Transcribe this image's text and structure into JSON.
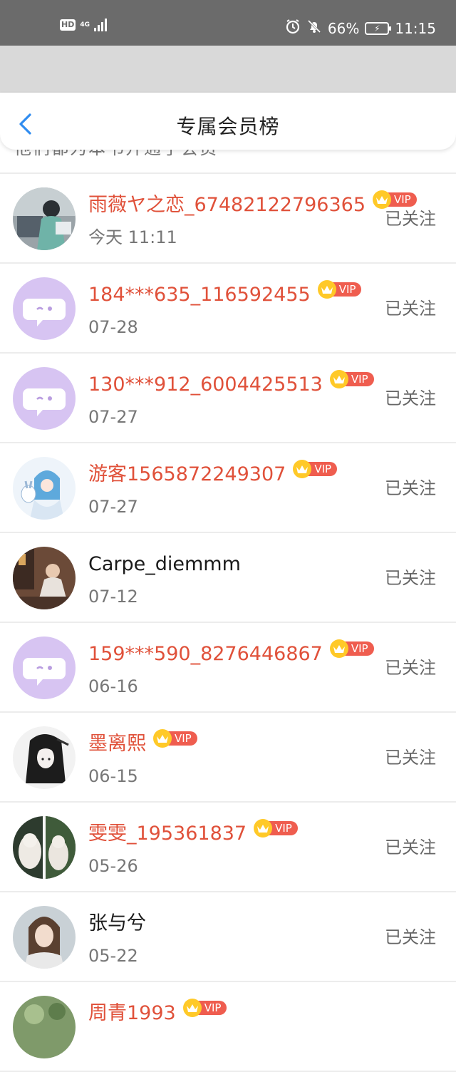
{
  "status_bar": {
    "hd": "HD",
    "network": "4G",
    "battery_percent": "66%",
    "time": "11:15",
    "icons": [
      "alarm-icon",
      "mute-bell-icon",
      "charging-battery-icon",
      "signal-bars-icon"
    ]
  },
  "header": {
    "title": "专属会员榜",
    "behind_text": "他们都为本书开通了会员"
  },
  "colors": {
    "vip_name": "#e0513a",
    "vip_tag": "#ef5d4f",
    "crown": "#ffc928",
    "back_arrow": "#2f8cf0",
    "status_bar": "#6b6b6b"
  },
  "members": [
    {
      "name": "雨薇ヤ之恋_67482122796365",
      "date": "今天 11:11",
      "vip": true,
      "vip_label": "VIP",
      "follow": "已关注",
      "avatar": "anime-girl-avatar"
    },
    {
      "name": "184***635_116592455",
      "date": "07-28",
      "vip": true,
      "vip_label": "VIP",
      "follow": "已关注",
      "avatar": "default-chat-avatar"
    },
    {
      "name": "130***912_6004425513",
      "date": "07-27",
      "vip": true,
      "vip_label": "VIP",
      "follow": "已关注",
      "avatar": "default-chat-avatar"
    },
    {
      "name": "游客1565872249307",
      "date": "07-27",
      "vip": true,
      "vip_label": "VIP",
      "follow": "已关注",
      "avatar": "anime-blue-avatar"
    },
    {
      "name": "Carpe_diemmm",
      "date": "07-12",
      "vip": false,
      "vip_label": "",
      "follow": "已关注",
      "avatar": "photo-person-avatar"
    },
    {
      "name": "159***590_8276446867",
      "date": "06-16",
      "vip": true,
      "vip_label": "VIP",
      "follow": "已关注",
      "avatar": "default-chat-avatar"
    },
    {
      "name": "墨离熙",
      "date": "06-15",
      "vip": true,
      "vip_label": "VIP",
      "follow": "已关注",
      "avatar": "anime-dark-avatar"
    },
    {
      "name": "雯雯_195361837",
      "date": "05-26",
      "vip": true,
      "vip_label": "VIP",
      "follow": "已关注",
      "avatar": "cats-avatar"
    },
    {
      "name": "张与兮",
      "date": "05-22",
      "vip": false,
      "vip_label": "",
      "follow": "已关注",
      "avatar": "photo-girl-avatar"
    },
    {
      "name": "周青1993",
      "date": "",
      "vip": true,
      "vip_label": "VIP",
      "follow": "",
      "avatar": "nature-avatar"
    }
  ]
}
